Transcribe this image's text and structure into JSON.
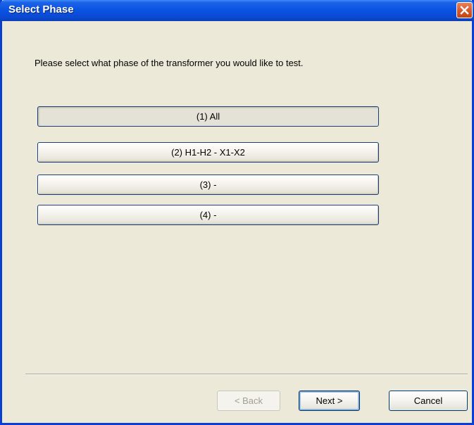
{
  "window": {
    "title": "Select Phase"
  },
  "prompt": "Please select what phase of the transformer you would like to test.",
  "phases": [
    {
      "label": "(1) All"
    },
    {
      "label": "(2) H1-H2 - X1-X2"
    },
    {
      "label": "(3)  -"
    },
    {
      "label": "(4)  -"
    }
  ],
  "nav": {
    "back_label": "< Back",
    "next_label": "Next >",
    "cancel_label": "Cancel"
  },
  "colors": {
    "title_bar": "#0a54e3",
    "window_bg": "#ece9d8",
    "close_button": "#d75a2c"
  }
}
